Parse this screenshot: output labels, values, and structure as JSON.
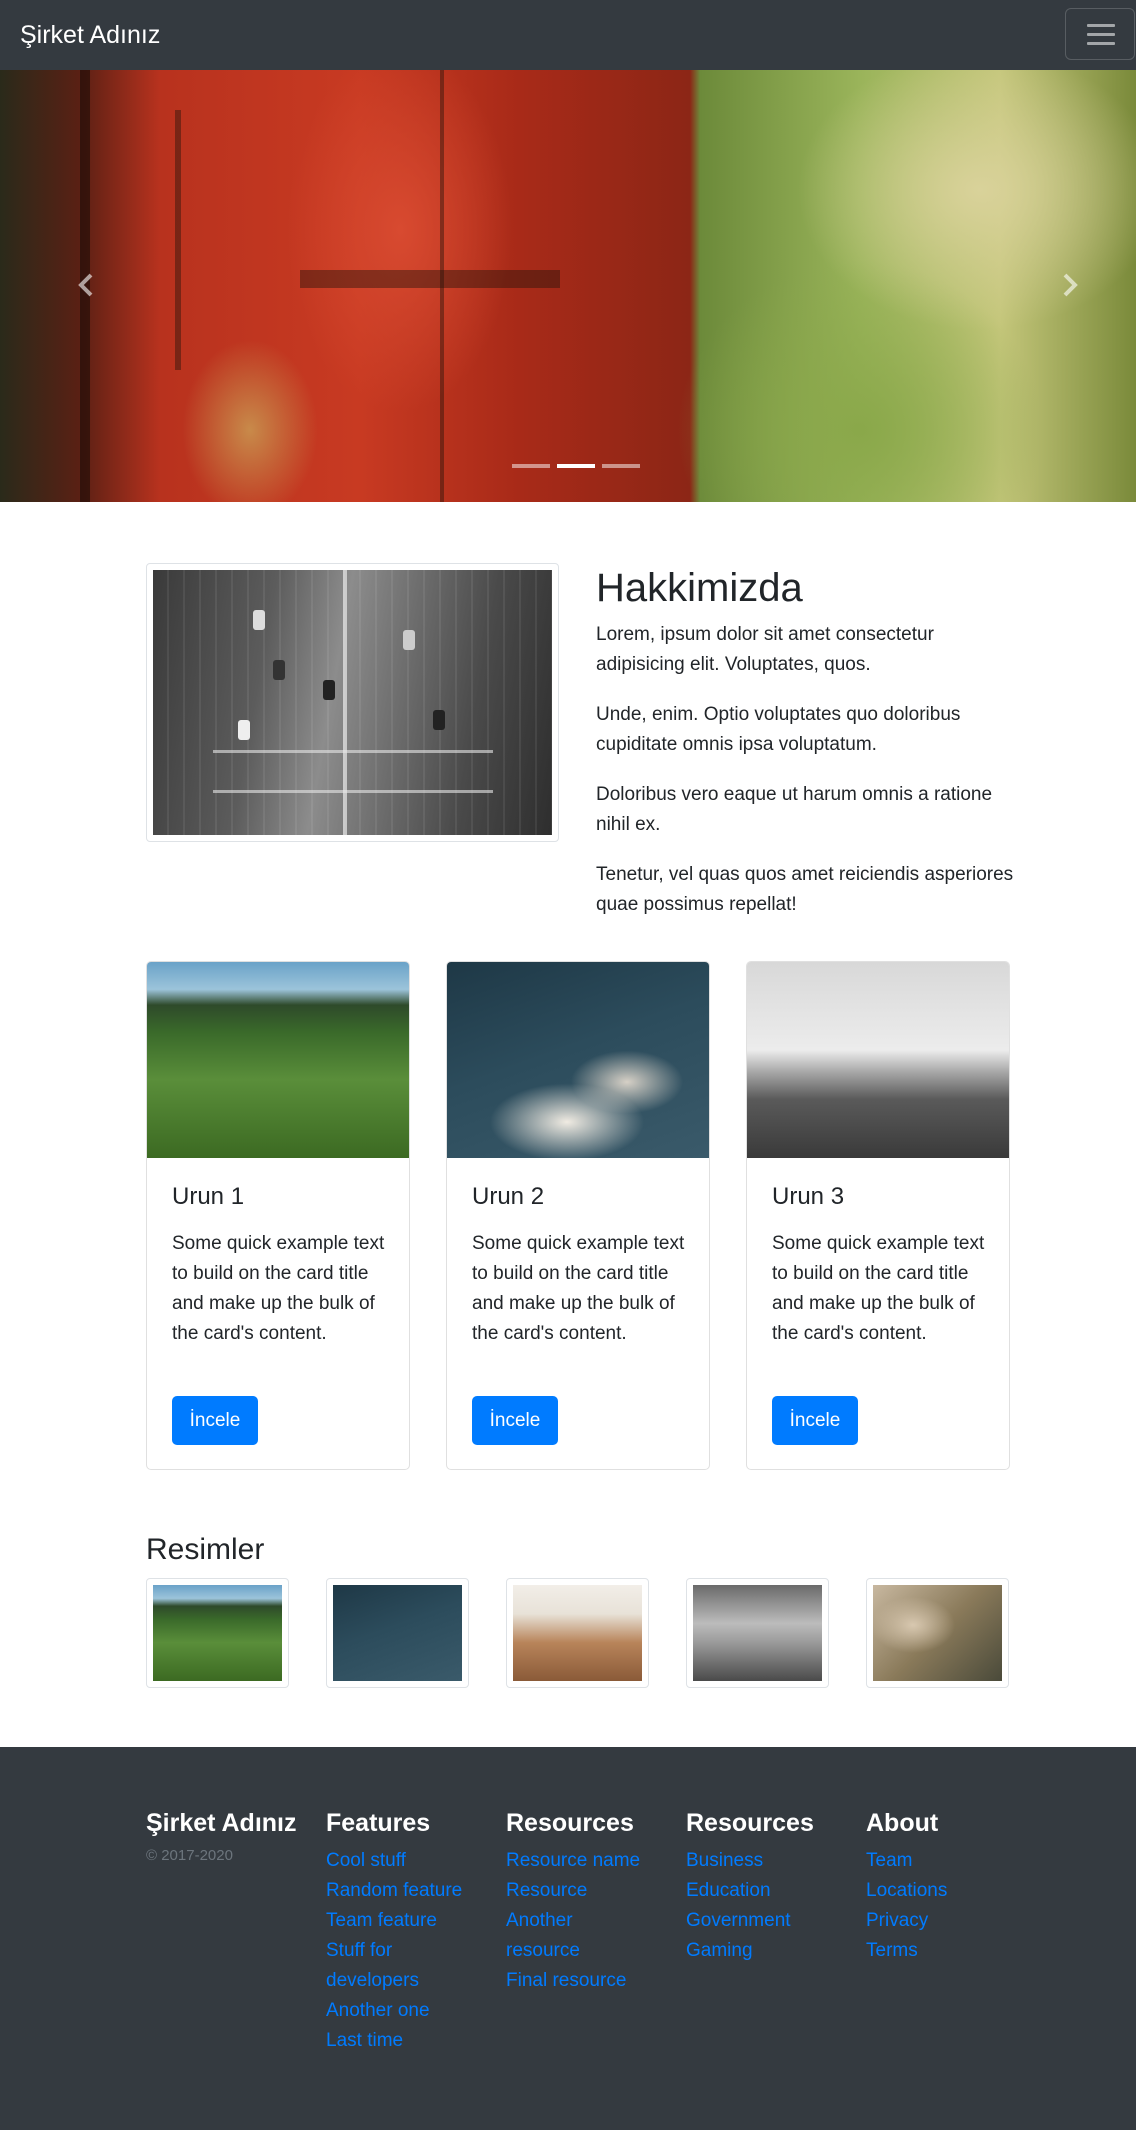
{
  "navbar": {
    "brand": "Şirket Adınız",
    "toggle_icon": "hamburger-menu-icon",
    "background": "#343a40"
  },
  "carousel": {
    "slide_count": 3,
    "active_index": 1,
    "prev_icon": "chevron-left-icon",
    "next_icon": "chevron-right-icon"
  },
  "about": {
    "title": "Hakkimizda",
    "paragraphs": [
      "Lorem, ipsum dolor sit amet consectetur adipisicing elit. Voluptates, quos.",
      "Unde, enim. Optio voluptates quo doloribus cupiditate omnis ipsa voluptatum.",
      "Doloribus vero eaque ut harum omnis a ratione nihil ex.",
      "Tenetur, vel quas quos amet reiciendis asperiores quae possimus repellat!"
    ]
  },
  "cards": [
    {
      "title": "Urun 1",
      "text": "Some quick example text to build on the card title and make up the bulk of the card's content.",
      "button": "İncele"
    },
    {
      "title": "Urun 2",
      "text": "Some quick example text to build on the card title and make up the bulk of the card's content.",
      "button": "İncele"
    },
    {
      "title": "Urun 3",
      "text": "Some quick example text to build on the card title and make up the bulk of the card's content.",
      "button": "İncele"
    }
  ],
  "gallery": {
    "title": "Resimler",
    "count": 5
  },
  "footer": {
    "brand": "Şirket Adınız",
    "copyright": "© 2017-2020",
    "columns": [
      {
        "heading": "Features",
        "links": [
          "Cool stuff",
          "Random feature",
          "Team feature",
          "Stuff for developers",
          "Another one",
          "Last time"
        ]
      },
      {
        "heading": "Resources",
        "links": [
          "Resource name",
          "Resource",
          "Another resource",
          "Final resource"
        ]
      },
      {
        "heading": "Resources",
        "links": [
          "Business",
          "Education",
          "Government",
          "Gaming"
        ]
      },
      {
        "heading": "About",
        "links": [
          "Team",
          "Locations",
          "Privacy",
          "Terms"
        ]
      }
    ]
  },
  "colors": {
    "primary": "#007bff",
    "dark": "#343a40",
    "muted": "#6c757d"
  }
}
